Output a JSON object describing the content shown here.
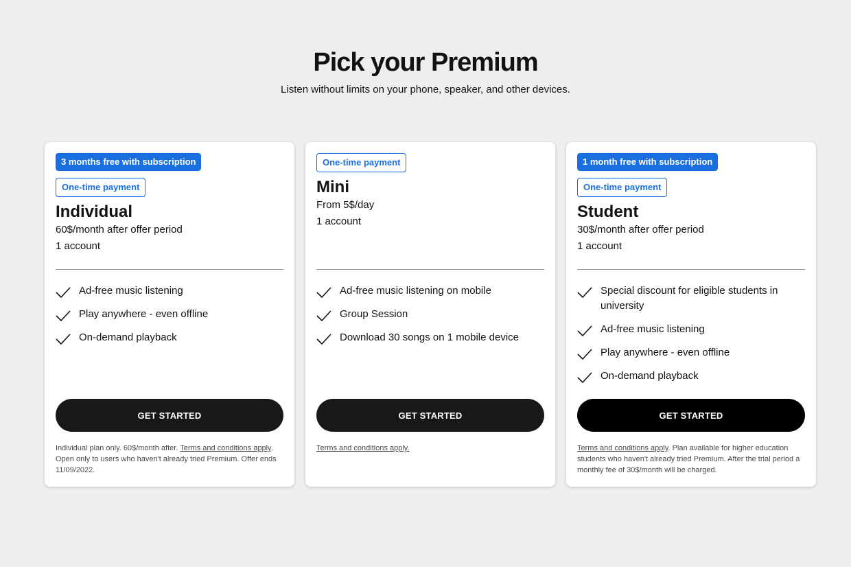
{
  "header": {
    "title": "Pick your Premium",
    "subtitle": "Listen without limits on your phone, speaker, and other devices."
  },
  "colors": {
    "accent": "#1a6fe0",
    "button": "#1a1717",
    "background": "#eeeeee"
  },
  "plans": [
    {
      "promo_badge": "3 months free with subscription",
      "payment_badge": "One-time payment",
      "name": "Individual",
      "price": "60$/month after offer period",
      "accounts": "1 account",
      "features": [
        "Ad-free music listening",
        "Play anywhere - even offline",
        "On-demand playback"
      ],
      "cta": "GET STARTED",
      "fine_pre": "Individual plan only. 60$/month after. ",
      "fine_link": "Terms and conditions apply",
      "fine_post": ". Open only to users who haven't already tried Premium. Offer ends 11/09/2022."
    },
    {
      "payment_badge": "One-time payment",
      "name": "Mini",
      "price": "From 5$/day",
      "accounts": "1 account",
      "features": [
        "Ad-free music listening on mobile",
        "Group Session",
        "Download 30 songs on 1 mobile device"
      ],
      "cta": "GET STARTED",
      "fine_link": "Terms and conditions apply."
    },
    {
      "promo_badge": "1 month free with subscription",
      "payment_badge": "One-time payment",
      "name": "Student",
      "price": "30$/month after offer period",
      "accounts": "1 account",
      "features": [
        "Special discount for eligible students in university",
        "Ad-free music listening",
        "Play anywhere - even offline",
        "On-demand playback"
      ],
      "cta": "GET STARTED",
      "fine_link": "Terms and conditions apply",
      "fine_post": ". Plan available for higher education students who haven't already tried Premium. After the trial period a monthly fee of 30$/month will be charged."
    }
  ]
}
